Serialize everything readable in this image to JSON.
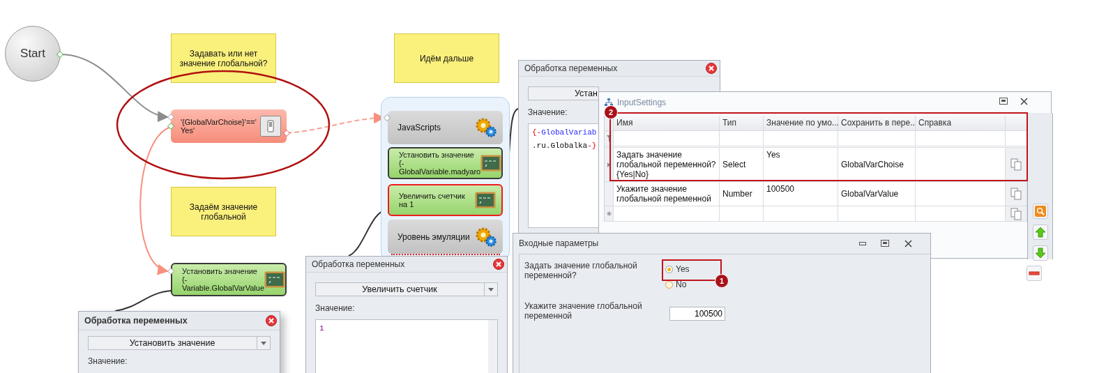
{
  "start": {
    "label": "Start"
  },
  "notes": [
    {
      "text": "Задавать или нет значение глобальной?"
    },
    {
      "text": "Идём дальше"
    },
    {
      "text": "Задаём значение глобальной"
    }
  ],
  "nodes": [
    {
      "kind": "condition",
      "lines": [
        "'{GlobalVarChoise}'=='",
        "Yes'"
      ],
      "selected": false
    },
    {
      "kind": "action",
      "lines": [
        "Установить значение",
        "{-",
        "Variable.GlobalVarValue"
      ],
      "selected": true
    }
  ],
  "group": {
    "items": [
      {
        "kind": "script",
        "lines": [
          "JavaScripts"
        ],
        "selected": false,
        "flagged": false
      },
      {
        "kind": "action",
        "lines": [
          "Установить значение",
          "{-",
          "GlobalVariable.madyaro"
        ],
        "selected": true,
        "flagged": false
      },
      {
        "kind": "action",
        "lines": [
          "Увеличить счетчик",
          "на 1"
        ],
        "selected": false,
        "flagged": true
      },
      {
        "kind": "script",
        "lines": [
          "Уровень эмуляции"
        ],
        "selected": false,
        "flagged": false
      }
    ]
  },
  "var_windows": [
    {
      "title": "Обработка переменных",
      "active": false,
      "action": "Устан",
      "value_label": "Значение:",
      "code": [
        [
          {
            "kind": "brace",
            "text": "{-"
          },
          {
            "kind": "name",
            "text": "GlobalVariab"
          }
        ],
        [
          {
            "kind": "plain",
            "text": ".ru.Globalka"
          },
          {
            "kind": "brace",
            "text": "-}"
          }
        ]
      ]
    },
    {
      "title": "Обработка переменных",
      "active": false,
      "action": "Увеличить счетчик",
      "value_label": "Значение:",
      "code": [
        [
          {
            "kind": "number",
            "text": "1"
          }
        ]
      ]
    },
    {
      "title": "Обработка переменных",
      "active": true,
      "action": "Установить значение",
      "value_label": "Значение:"
    }
  ],
  "settings": {
    "title": "InputSettings",
    "columns": [
      "Имя",
      "Тип",
      "Значение по умо...",
      "Сохранить в пере...",
      "Справка"
    ],
    "rows": [
      {
        "name": "Задать значение глобальной переменной?{Yes|No}",
        "type": "Select",
        "default": "Yes",
        "variable": "GlobalVarChoise",
        "current": true
      },
      {
        "name": "Укажите значение глобальной переменной",
        "type": "Number",
        "default": "100500",
        "variable": "GlobalVarValue",
        "current": false
      }
    ],
    "annotation": "2"
  },
  "params": {
    "title": "Входные параметры",
    "annotation": "1",
    "fields": [
      {
        "kind": "radio",
        "label": "Задать значение глобальной переменной?",
        "options": [
          {
            "label": "Yes",
            "selected": true
          },
          {
            "label": "No",
            "selected": false
          }
        ]
      },
      {
        "kind": "number",
        "label": "Укажите значение глобальной переменной",
        "value": "100500"
      }
    ]
  }
}
